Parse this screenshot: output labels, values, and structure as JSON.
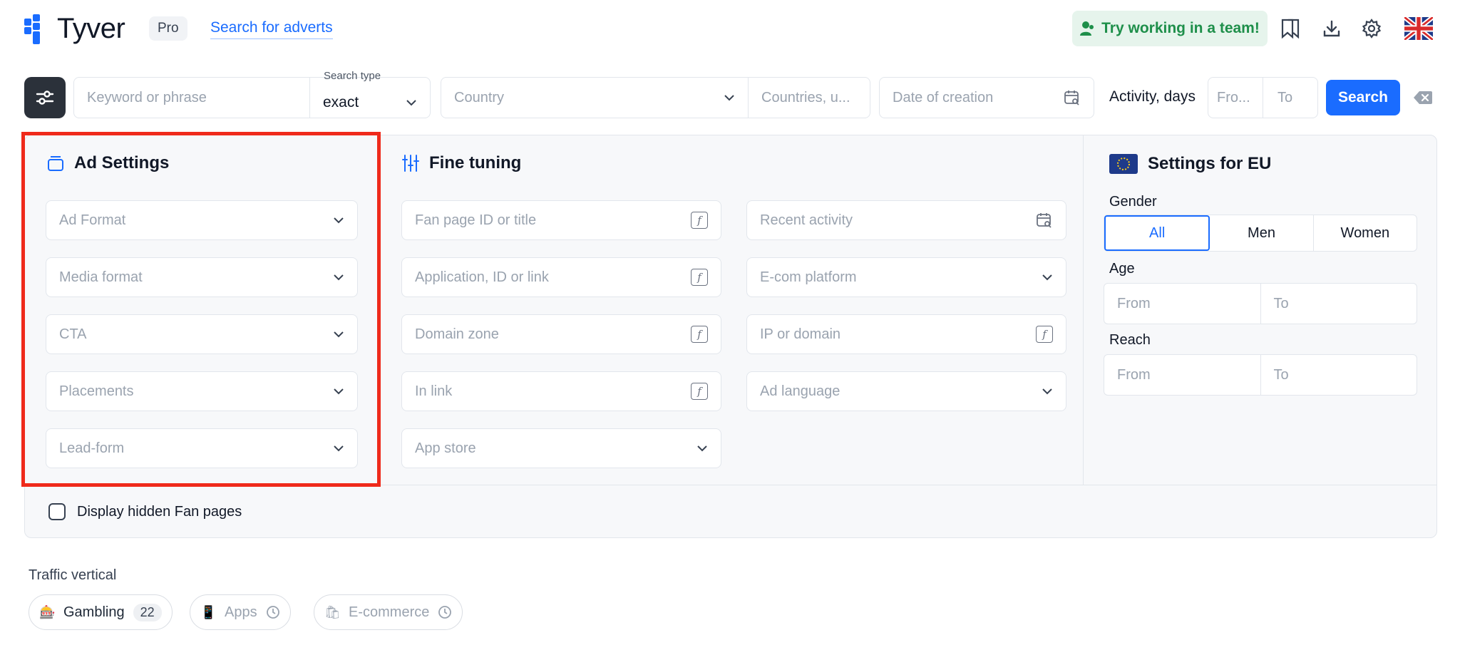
{
  "header": {
    "logo_text": "Tyver",
    "plan_badge": "Pro",
    "search_adverts_link": "Search for adverts",
    "team_button": "Try working in a team!"
  },
  "search_bar": {
    "keyword_placeholder": "Keyword or phrase",
    "search_type_label": "Search type",
    "search_type_value": "exact",
    "country_placeholder": "Country",
    "countries_placeholder": "Countries, u...",
    "date_placeholder": "Date of creation",
    "activity_label": "Activity, days",
    "activity_from": "Fro...",
    "activity_to": "To",
    "search_button": "Search"
  },
  "ad_settings": {
    "title": "Ad Settings",
    "fields": [
      "Ad Format",
      "Media format",
      "CTA",
      "Placements",
      "Lead-form"
    ]
  },
  "fine_tuning": {
    "title": "Fine tuning",
    "left_fields": [
      "Fan page ID or title",
      "Application, ID or link",
      "Domain zone",
      "In link",
      "App store"
    ],
    "right_fields": [
      "Recent activity",
      "E-com platform",
      "IP or domain",
      "Ad language"
    ]
  },
  "eu_settings": {
    "title": "Settings for EU",
    "gender_label": "Gender",
    "gender_options": [
      "All",
      "Men",
      "Women"
    ],
    "selected_gender": "All",
    "age_label": "Age",
    "age_from": "From",
    "age_to": "To",
    "reach_label": "Reach",
    "reach_from": "From",
    "reach_to": "To"
  },
  "display_hidden_label": "Display hidden Fan pages",
  "traffic_vertical": {
    "label": "Traffic vertical",
    "chips": [
      {
        "label": "Gambling",
        "count": "22",
        "emoji": "🎰"
      },
      {
        "label": "Apps",
        "emoji": "📱"
      },
      {
        "label": "E-commerce",
        "emoji": "🛍"
      }
    ]
  },
  "colors": {
    "accent": "#1a6cff",
    "highlight": "#ef2a1b",
    "team_green": "#1e8f4a"
  }
}
